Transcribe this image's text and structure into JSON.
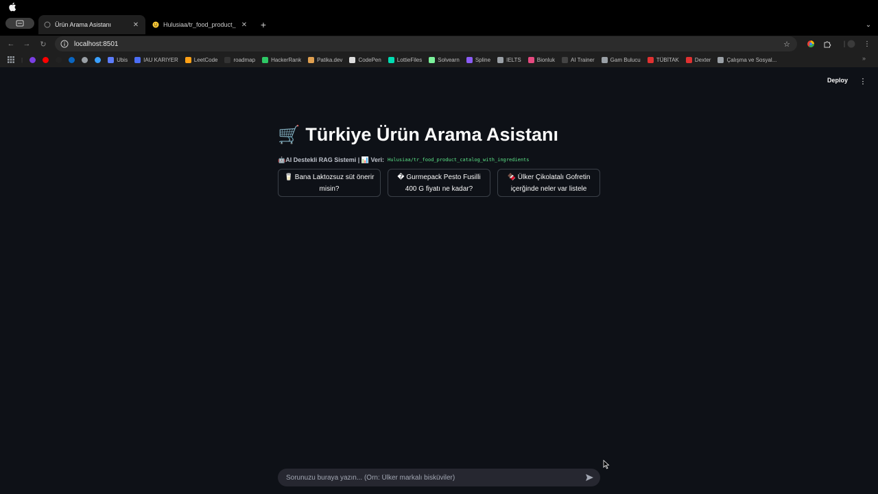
{
  "browser": {
    "tabs": [
      {
        "title": "Ürün Arama Asistanı",
        "active": true
      },
      {
        "title": "Hulusiaa/tr_food_product_ca",
        "active": false
      }
    ],
    "url": "localhost:8501",
    "bookmarks": [
      {
        "label": "",
        "color": "#7b3fe4"
      },
      {
        "label": "",
        "color": "#ff0000"
      },
      {
        "label": "",
        "color": "#222222"
      },
      {
        "label": "",
        "color": "#0a66c2"
      },
      {
        "label": "",
        "color": "#9aa0a6"
      },
      {
        "label": "",
        "color": "#3aa0ff"
      },
      {
        "label": "Ubis",
        "color": "#5c7cfa"
      },
      {
        "label": "IAU KARIYER",
        "color": "#4c6ef5"
      },
      {
        "label": "LeetCode",
        "color": "#ffa116"
      },
      {
        "label": "roadmap",
        "color": "#333333"
      },
      {
        "label": "HackerRank",
        "color": "#2ec866"
      },
      {
        "label": "Patika.dev",
        "color": "#e0a050"
      },
      {
        "label": "CodePen",
        "color": "#dddddd"
      },
      {
        "label": "LottieFiles",
        "color": "#00ddb3"
      },
      {
        "label": "Solvearn",
        "color": "#7cf29c"
      },
      {
        "label": "Spline",
        "color": "#8b5cf6"
      },
      {
        "label": "IELTS",
        "color": "#9aa0a6"
      },
      {
        "label": "Bionluk",
        "color": "#e64980"
      },
      {
        "label": "AI Trainer",
        "color": "#444444"
      },
      {
        "label": "Gam Bulucu",
        "color": "#9aa0a6"
      },
      {
        "label": "TÜBİTAK",
        "color": "#e03131"
      },
      {
        "label": "Dexter",
        "color": "#e03131"
      },
      {
        "label": "Çalışma ve Sosyal...",
        "color": "#9aa0a6"
      }
    ]
  },
  "app": {
    "deploy_label": "Deploy",
    "title_icon": "🛒",
    "title": "Türkiye Ürün Arama Asistanı",
    "caption_prefix": "🤖AI Destekli RAG Sistemi | 📊 Veri:",
    "caption_dataset": "Hulusiaa/tr_food_product_catalog_with_ingredients",
    "suggestions": [
      "🥛 Bana Laktozsuz süt önerir misin?",
      "� Gurmepack Pesto Fusilli 400 G fiyatı ne kadar?",
      "🍫 Ülker Çikolatalı Gofretin içerğinde neler var listele"
    ],
    "chat_placeholder": "Sorunuzu buraya yazın... (Örn: Ülker markalı bisküviler)"
  },
  "colors": {
    "background": "#0e1117",
    "dataset_code": "#5ce488",
    "input_bg": "#262730"
  }
}
